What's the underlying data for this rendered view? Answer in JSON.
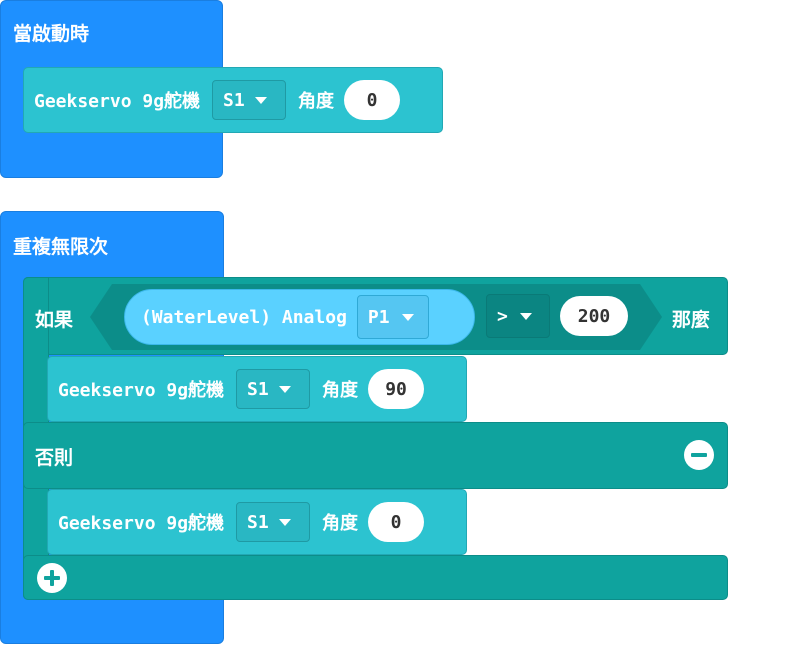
{
  "on_start": {
    "label": "當啟動時",
    "servo": {
      "label": "Geekservo 9g舵機",
      "port": "S1",
      "angle_label": "角度",
      "angle": "0"
    }
  },
  "forever": {
    "label": "重複無限次",
    "if_block": {
      "if_label": "如果",
      "then_label": "那麼",
      "else_label": "否則",
      "condition": {
        "sensor_label": "(WaterLevel) Analog",
        "pin": "P1",
        "operator": ">",
        "value": "200"
      },
      "then_servo": {
        "label": "Geekservo 9g舵機",
        "port": "S1",
        "angle_label": "角度",
        "angle": "90"
      },
      "else_servo": {
        "label": "Geekservo 9g舵機",
        "port": "S1",
        "angle_label": "角度",
        "angle": "0"
      }
    }
  },
  "colors": {
    "event_blue": "#1e90ff",
    "servo_teal": "#2cc3d0",
    "logic_teal": "#0fa39e",
    "sensor_blue": "#5ad1ff"
  }
}
